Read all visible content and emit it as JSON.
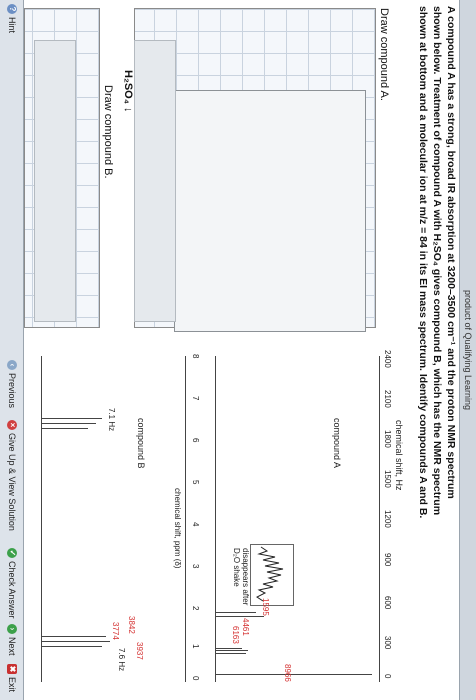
{
  "header": {
    "title": "product of Qualifying Learning"
  },
  "question": {
    "line1": "A compound A has a strong, broad IR absorption at 3200–3500 cm⁻¹ and the proton NMR spectrum",
    "line2": "shown below. Treatment of compound A with H₂SO₄ gives compound B, which has the NMR spectrum",
    "line3": "shown at bottom and a molecular ion at m/z = 84 in its EI mass spectrum. Identify compounds A and B."
  },
  "draw_a": {
    "label": "Draw compound A."
  },
  "draw_b": {
    "label": "Draw compound B."
  },
  "reagent": {
    "label": "H₂SO₄"
  },
  "spectrum_a": {
    "axis_title": "chemical shift, Hz",
    "ticks": [
      "2400",
      "2100",
      "1800",
      "1500",
      "1200",
      "900",
      "600",
      "300",
      "0"
    ],
    "compound_label": "compound A",
    "note_line1": "disappears after",
    "note_line2": "D₂O shake",
    "peak_values": [
      "8966",
      "4461",
      "1595",
      "6163"
    ]
  },
  "spectrum_b": {
    "axis_title": "chemical shift, ppm (δ)",
    "ticks": [
      "8",
      "7",
      "6",
      "5",
      "4",
      "3",
      "2",
      "1",
      "0"
    ],
    "compound_label": "compound B",
    "coupling_left": "7.1 Hz",
    "coupling_right": "7.6 Hz",
    "peak_values": [
      "3842",
      "3937",
      "3774"
    ]
  },
  "buttons": {
    "previous": "Previous",
    "give_up": "Give Up & View Solution",
    "check": "Check Answer",
    "next": "Next",
    "exit": "Exit",
    "hint": "Hint"
  }
}
